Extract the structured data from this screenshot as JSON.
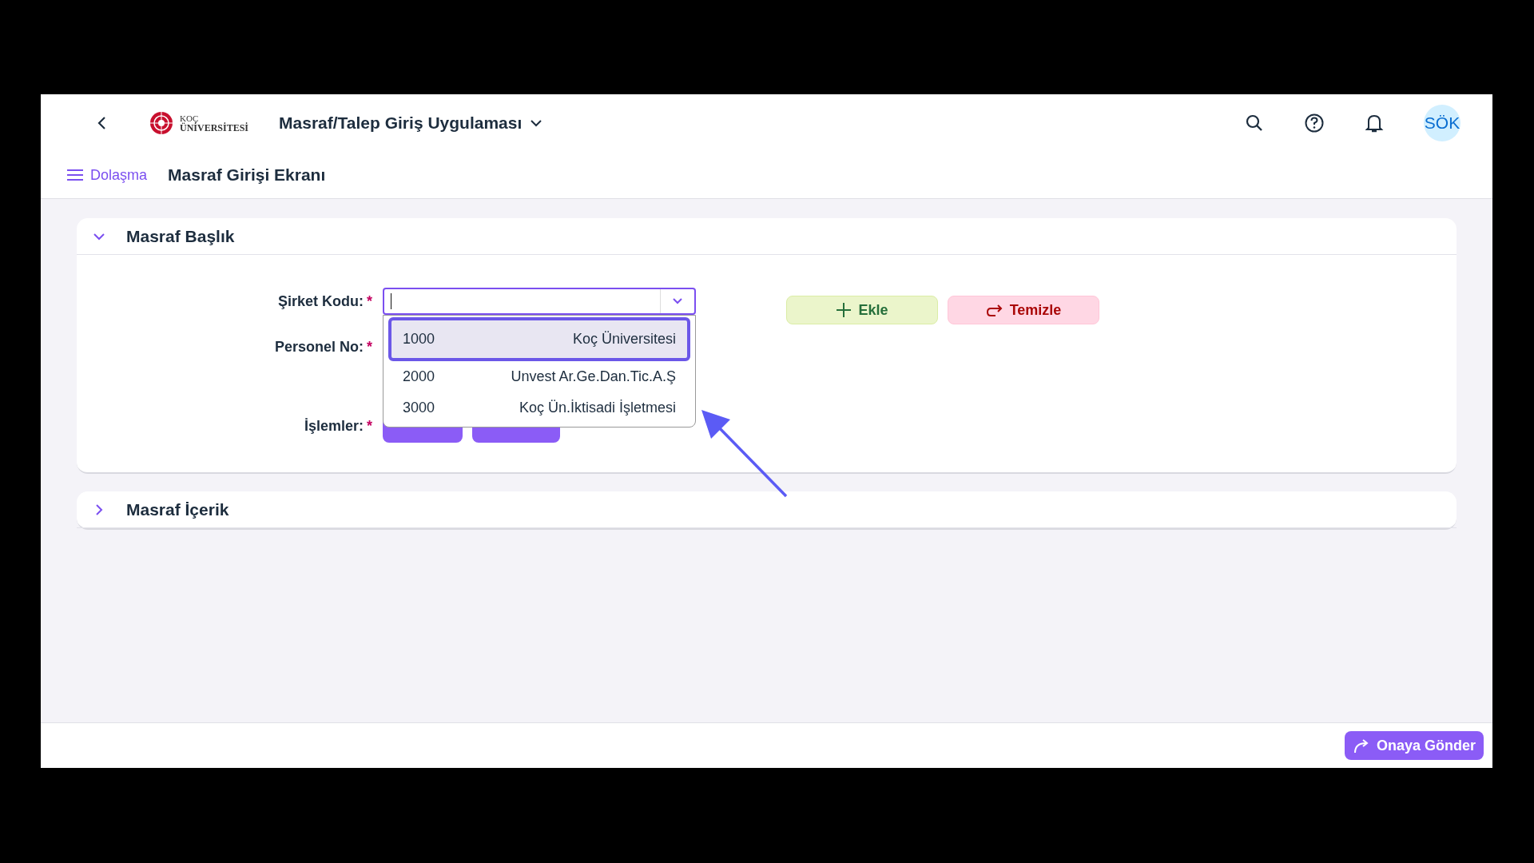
{
  "header": {
    "logo_line1": "KOÇ",
    "logo_line2": "ÜNİVERSİTESİ",
    "app_title": "Masraf/Talep Giriş Uygulaması",
    "avatar": "SÖK"
  },
  "nav": {
    "menu_label": "Dolaşma",
    "page_title": "Masraf Girişi Ekranı"
  },
  "sections": [
    {
      "title": "Masraf Başlık",
      "expanded": true
    },
    {
      "title": "Masraf İçerik",
      "expanded": false
    }
  ],
  "form": {
    "required_mark": "*",
    "fields": [
      {
        "label": "Şirket Kodu:",
        "kind": "combo"
      },
      {
        "label": "Personel No:",
        "kind": "text"
      },
      {
        "label": "İşlemler:",
        "kind": "actions"
      }
    ]
  },
  "dropdown": {
    "options": [
      {
        "code": "1000",
        "name": "Koç Üniversitesi",
        "selected": true
      },
      {
        "code": "2000",
        "name": "Unvest Ar.Ge.Dan.Tic.A.Ş",
        "selected": false
      },
      {
        "code": "3000",
        "name": "Koç Ün.İktisadi İşletmesi",
        "selected": false
      }
    ]
  },
  "actions": [
    {
      "label": "Ekle",
      "kind": "add"
    },
    {
      "label": "Temizle",
      "kind": "clear"
    }
  ],
  "footer": {
    "submit": "Onaya Gönder"
  }
}
